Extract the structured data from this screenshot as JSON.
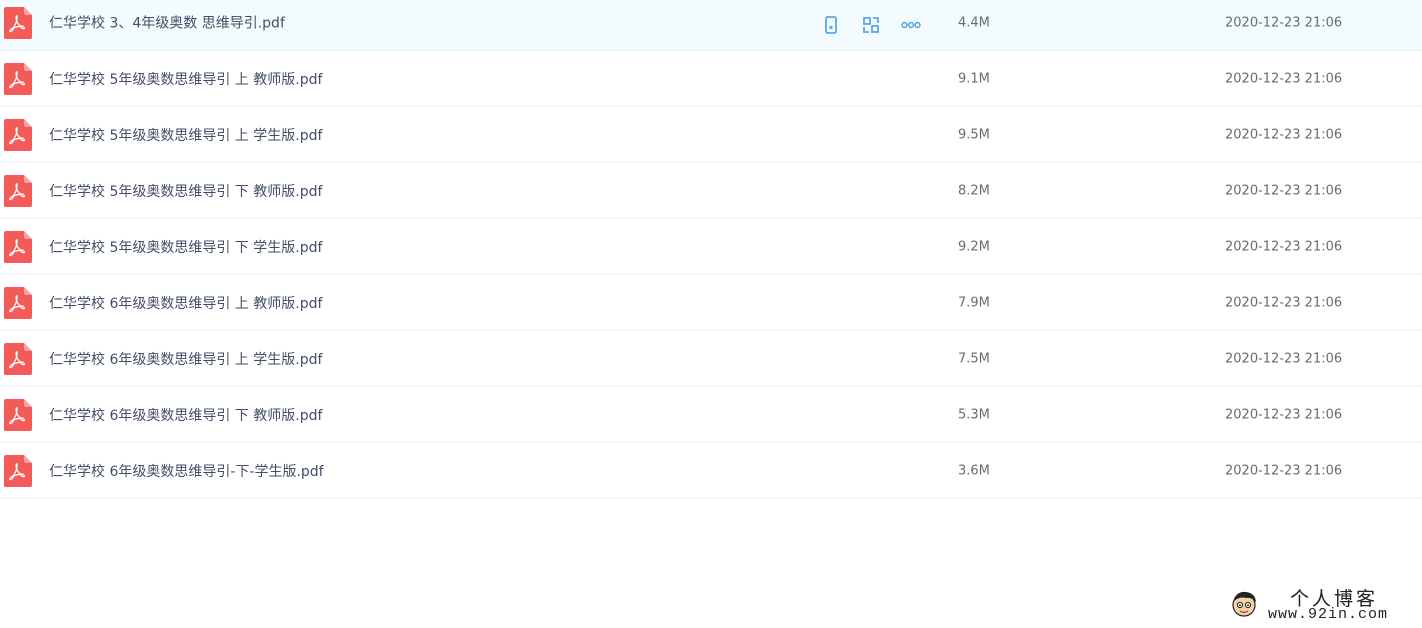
{
  "files": [
    {
      "name": "仁华学校 3、4年级奥数 思维导引.pdf",
      "size": "4.4M",
      "date": "2020-12-23 21:06"
    },
    {
      "name": "仁华学校 5年级奥数思维导引 上 教师版.pdf",
      "size": "9.1M",
      "date": "2020-12-23 21:06"
    },
    {
      "name": "仁华学校 5年级奥数思维导引 上 学生版.pdf",
      "size": "9.5M",
      "date": "2020-12-23 21:06"
    },
    {
      "name": "仁华学校 5年级奥数思维导引 下 教师版.pdf",
      "size": "8.2M",
      "date": "2020-12-23 21:06"
    },
    {
      "name": "仁华学校 5年级奥数思维导引 下 学生版.pdf",
      "size": "9.2M",
      "date": "2020-12-23 21:06"
    },
    {
      "name": "仁华学校 6年级奥数思维导引 上 教师版.pdf",
      "size": "7.9M",
      "date": "2020-12-23 21:06"
    },
    {
      "name": "仁华学校 6年级奥数思维导引 上 学生版.pdf",
      "size": "7.5M",
      "date": "2020-12-23 21:06"
    },
    {
      "name": "仁华学校 6年级奥数思维导引 下 教师版.pdf",
      "size": "5.3M",
      "date": "2020-12-23 21:06"
    },
    {
      "name": "仁华学校 6年级奥数思维导引-下-学生版.pdf",
      "size": "3.6M",
      "date": "2020-12-23 21:06"
    }
  ],
  "row_actions": {
    "icons": [
      "phone-icon",
      "share-icon",
      "more-icon"
    ],
    "accent_color": "#5aa9e6"
  },
  "file_icon": {
    "name": "pdf-icon",
    "color": "#f25b57"
  },
  "watermark": {
    "title": "个人博客",
    "url": "www.92in.com"
  }
}
